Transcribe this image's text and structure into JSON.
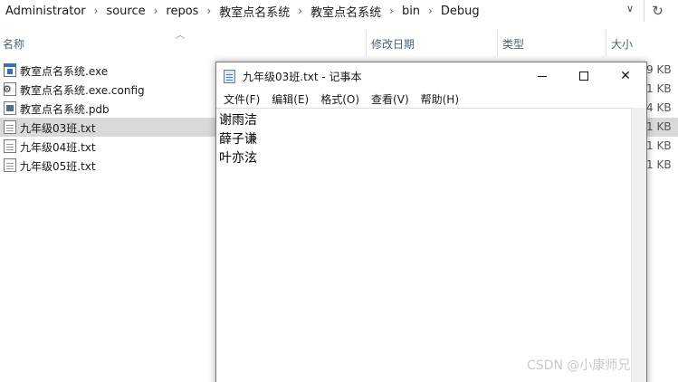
{
  "explorer": {
    "breadcrumbs": [
      "Administrator",
      "source",
      "repos",
      "教室点名系统",
      "教室点名系统",
      "bin",
      "Debug"
    ],
    "separator": "›",
    "dropdown_icon": "∨",
    "refresh_icon": "↻",
    "columns": {
      "name": "名称",
      "modified": "修改日期",
      "type": "类型",
      "size": "大小"
    },
    "files": [
      {
        "name": "教室点名系统.exe",
        "size": "9 KB",
        "icon": "exe-icon"
      },
      {
        "name": "教室点名系统.exe.config",
        "size": "1 KB",
        "icon": "config-icon"
      },
      {
        "name": "教室点名系统.pdb",
        "size": "4 KB",
        "icon": "pdb-icon"
      },
      {
        "name": "九年级03班.txt",
        "size": "1 KB",
        "icon": "txt-icon"
      },
      {
        "name": "九年级04班.txt",
        "size": "1 KB",
        "icon": "txt-icon"
      },
      {
        "name": "九年级05班.txt",
        "size": "1 KB",
        "icon": "txt-icon"
      }
    ],
    "selected_index": 3
  },
  "notepad": {
    "title": "九年级03班.txt - 记事本",
    "menu": [
      "文件(F)",
      "编辑(E)",
      "格式(O)",
      "查看(V)",
      "帮助(H)"
    ],
    "lines": [
      "谢雨洁",
      "薛子谦",
      "叶亦泫"
    ],
    "close_icon": "✕"
  },
  "watermark": "CSDN @小康师兄"
}
